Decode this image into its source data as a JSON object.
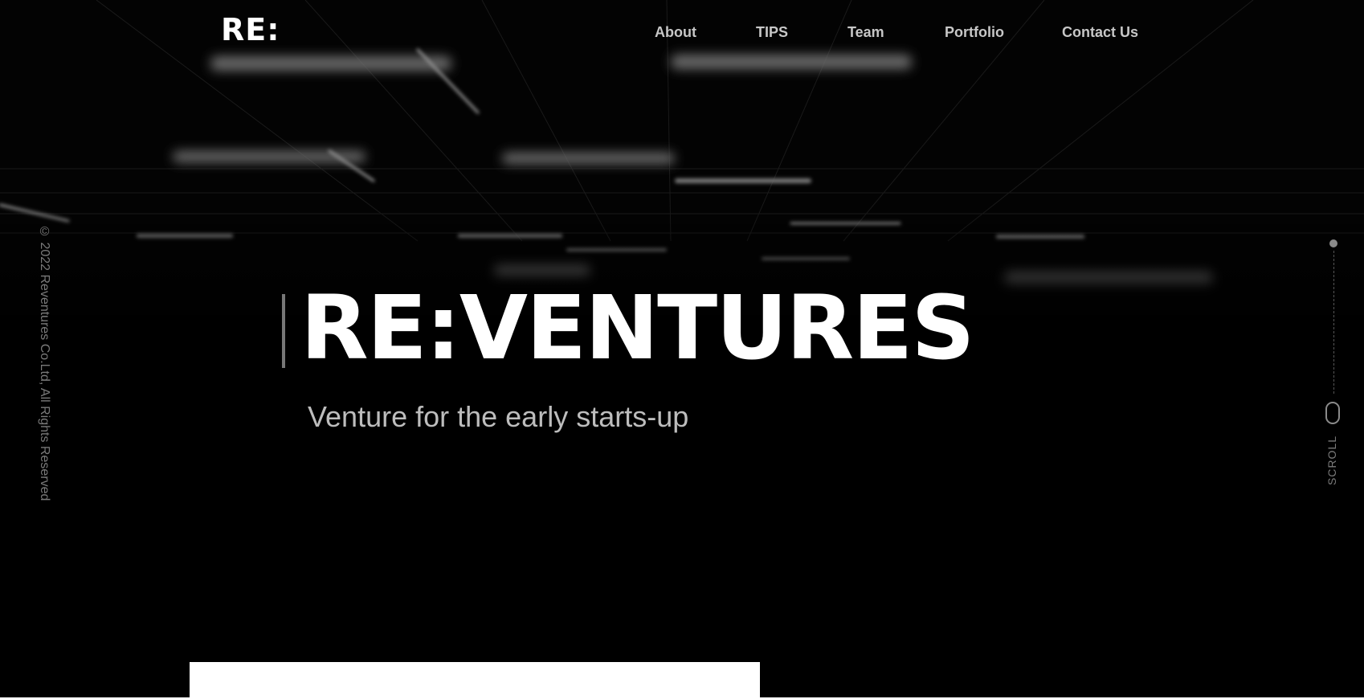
{
  "header": {
    "logo": "RE:",
    "nav": [
      "About",
      "TIPS",
      "Team",
      "Portfolio",
      "Contact Us"
    ]
  },
  "side": {
    "copyright": "© 2022 Reventures Co.Ltd, All Rights Reserved"
  },
  "hero": {
    "title": "RE:VENTURES",
    "subtitle": "Venture for the early starts-up",
    "background_icon": "perspective-grid-graphic"
  },
  "scroll": {
    "label": "SCROLL",
    "icon": "mouse-icon"
  },
  "colors": {
    "background": "#000000",
    "text_primary": "#ffffff",
    "text_secondary": "#bdbdbd",
    "nav_text": "#c7c7c7",
    "muted": "#7a7a7a"
  }
}
